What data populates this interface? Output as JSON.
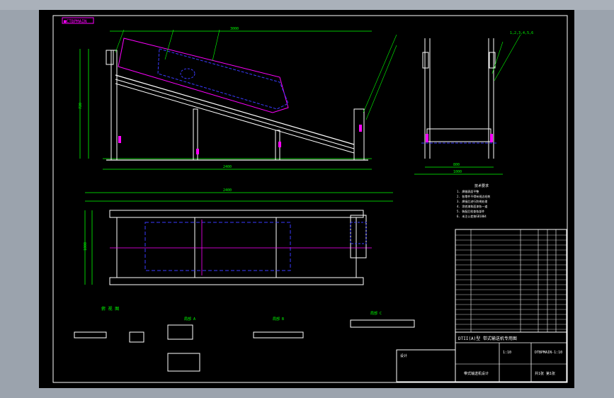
{
  "viewport": {
    "background": "#000000",
    "tag_label": "■CTBPMAIN",
    "top_right_callout": "1,2,3,4,5,6"
  },
  "views": {
    "front_view_dims": {
      "overall": "3000",
      "height": "720",
      "span": "2400"
    },
    "plan_view": {
      "label": "俯 视 图",
      "length": "2400",
      "width": "1000"
    },
    "section_labels": [
      "局部 A",
      "局部 B",
      "局部 C"
    ],
    "side_view_dims": {
      "width": "800",
      "base": "1000"
    }
  },
  "notes": {
    "title": "技术要求",
    "lines": [
      "1. 焊缝表面平整",
      "2. 各零件不得有锐边毛刺",
      "3. 焊接后进行防锈处理",
      "4. 涂底漆和面漆各一道",
      "5. 装配后检查各部件",
      "6. 未注公差按GB1804"
    ]
  },
  "title_block": {
    "drawing_title": "DTII(A)型 带式输送机专用图",
    "scale": "1:10",
    "drawing_no": "DTBPMAIN-1:10",
    "designer_label": "设计",
    "company": "带式输送机设计",
    "sheet": "共1张 第1张"
  },
  "colors": {
    "green": "#00ff00",
    "white": "#ffffff",
    "magenta": "#ff00ff",
    "blue": "#3a3aff",
    "yellow": "#ffff00",
    "cyan": "#00ffff"
  }
}
